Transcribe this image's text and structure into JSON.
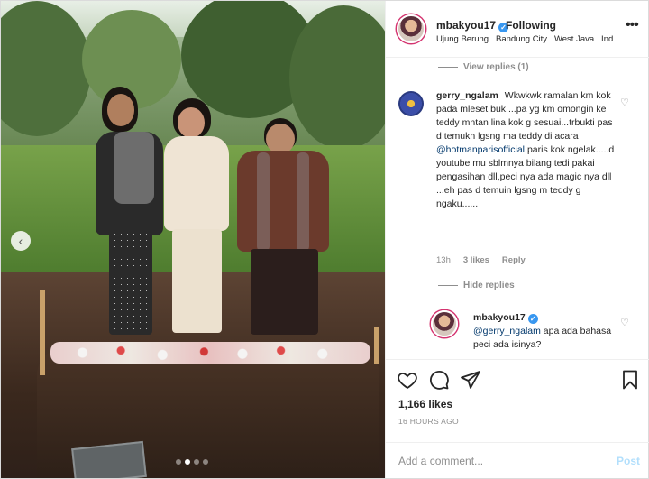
{
  "post": {
    "username": "mbakyou17",
    "follow_status": "Following",
    "location": "Ujung Berung . Bandung City . West Java . Ind...",
    "more_icon": "more-horizontal-icon"
  },
  "photo": {
    "nav_glyph": "‹",
    "dots_total": 4,
    "active_dot": 2
  },
  "comments": {
    "view_replies_top": "View replies (1)",
    "gerry": {
      "username": "gerry_ngalam",
      "text_before_mention": "Wkwkwk ramalan km kok pada mleset buk....pa yg km omongin ke teddy mntan lina kok g sesuai...trbukti pas d temukn lgsng ma teddy di acara",
      "mention": "@hotmanparisofficial",
      "text_after_mention": "paris kok ngelak.....d youtube mu sblmnya bilang tedi pakai pengasihan dll,peci nya ada magic nya dll ...eh pas d temuin lgsng m teddy g ngaku......",
      "time": "13h",
      "likes": "3 likes",
      "reply_label": "Reply",
      "hide_replies": "Hide replies"
    },
    "reply": {
      "username": "mbakyou17",
      "mention": "@gerry_ngalam",
      "text": "apa ada bahasa peci ada isinya?"
    }
  },
  "actions": {
    "likes": "1,166 likes",
    "time_ago": "16 HOURS AGO",
    "comment_placeholder": "Add a comment...",
    "post_label": "Post"
  },
  "colors": {
    "accent_link": "#00376b",
    "verified": "#3897f0",
    "post_disabled": "#b2dffc",
    "muted_text": "#8e8e8e"
  }
}
